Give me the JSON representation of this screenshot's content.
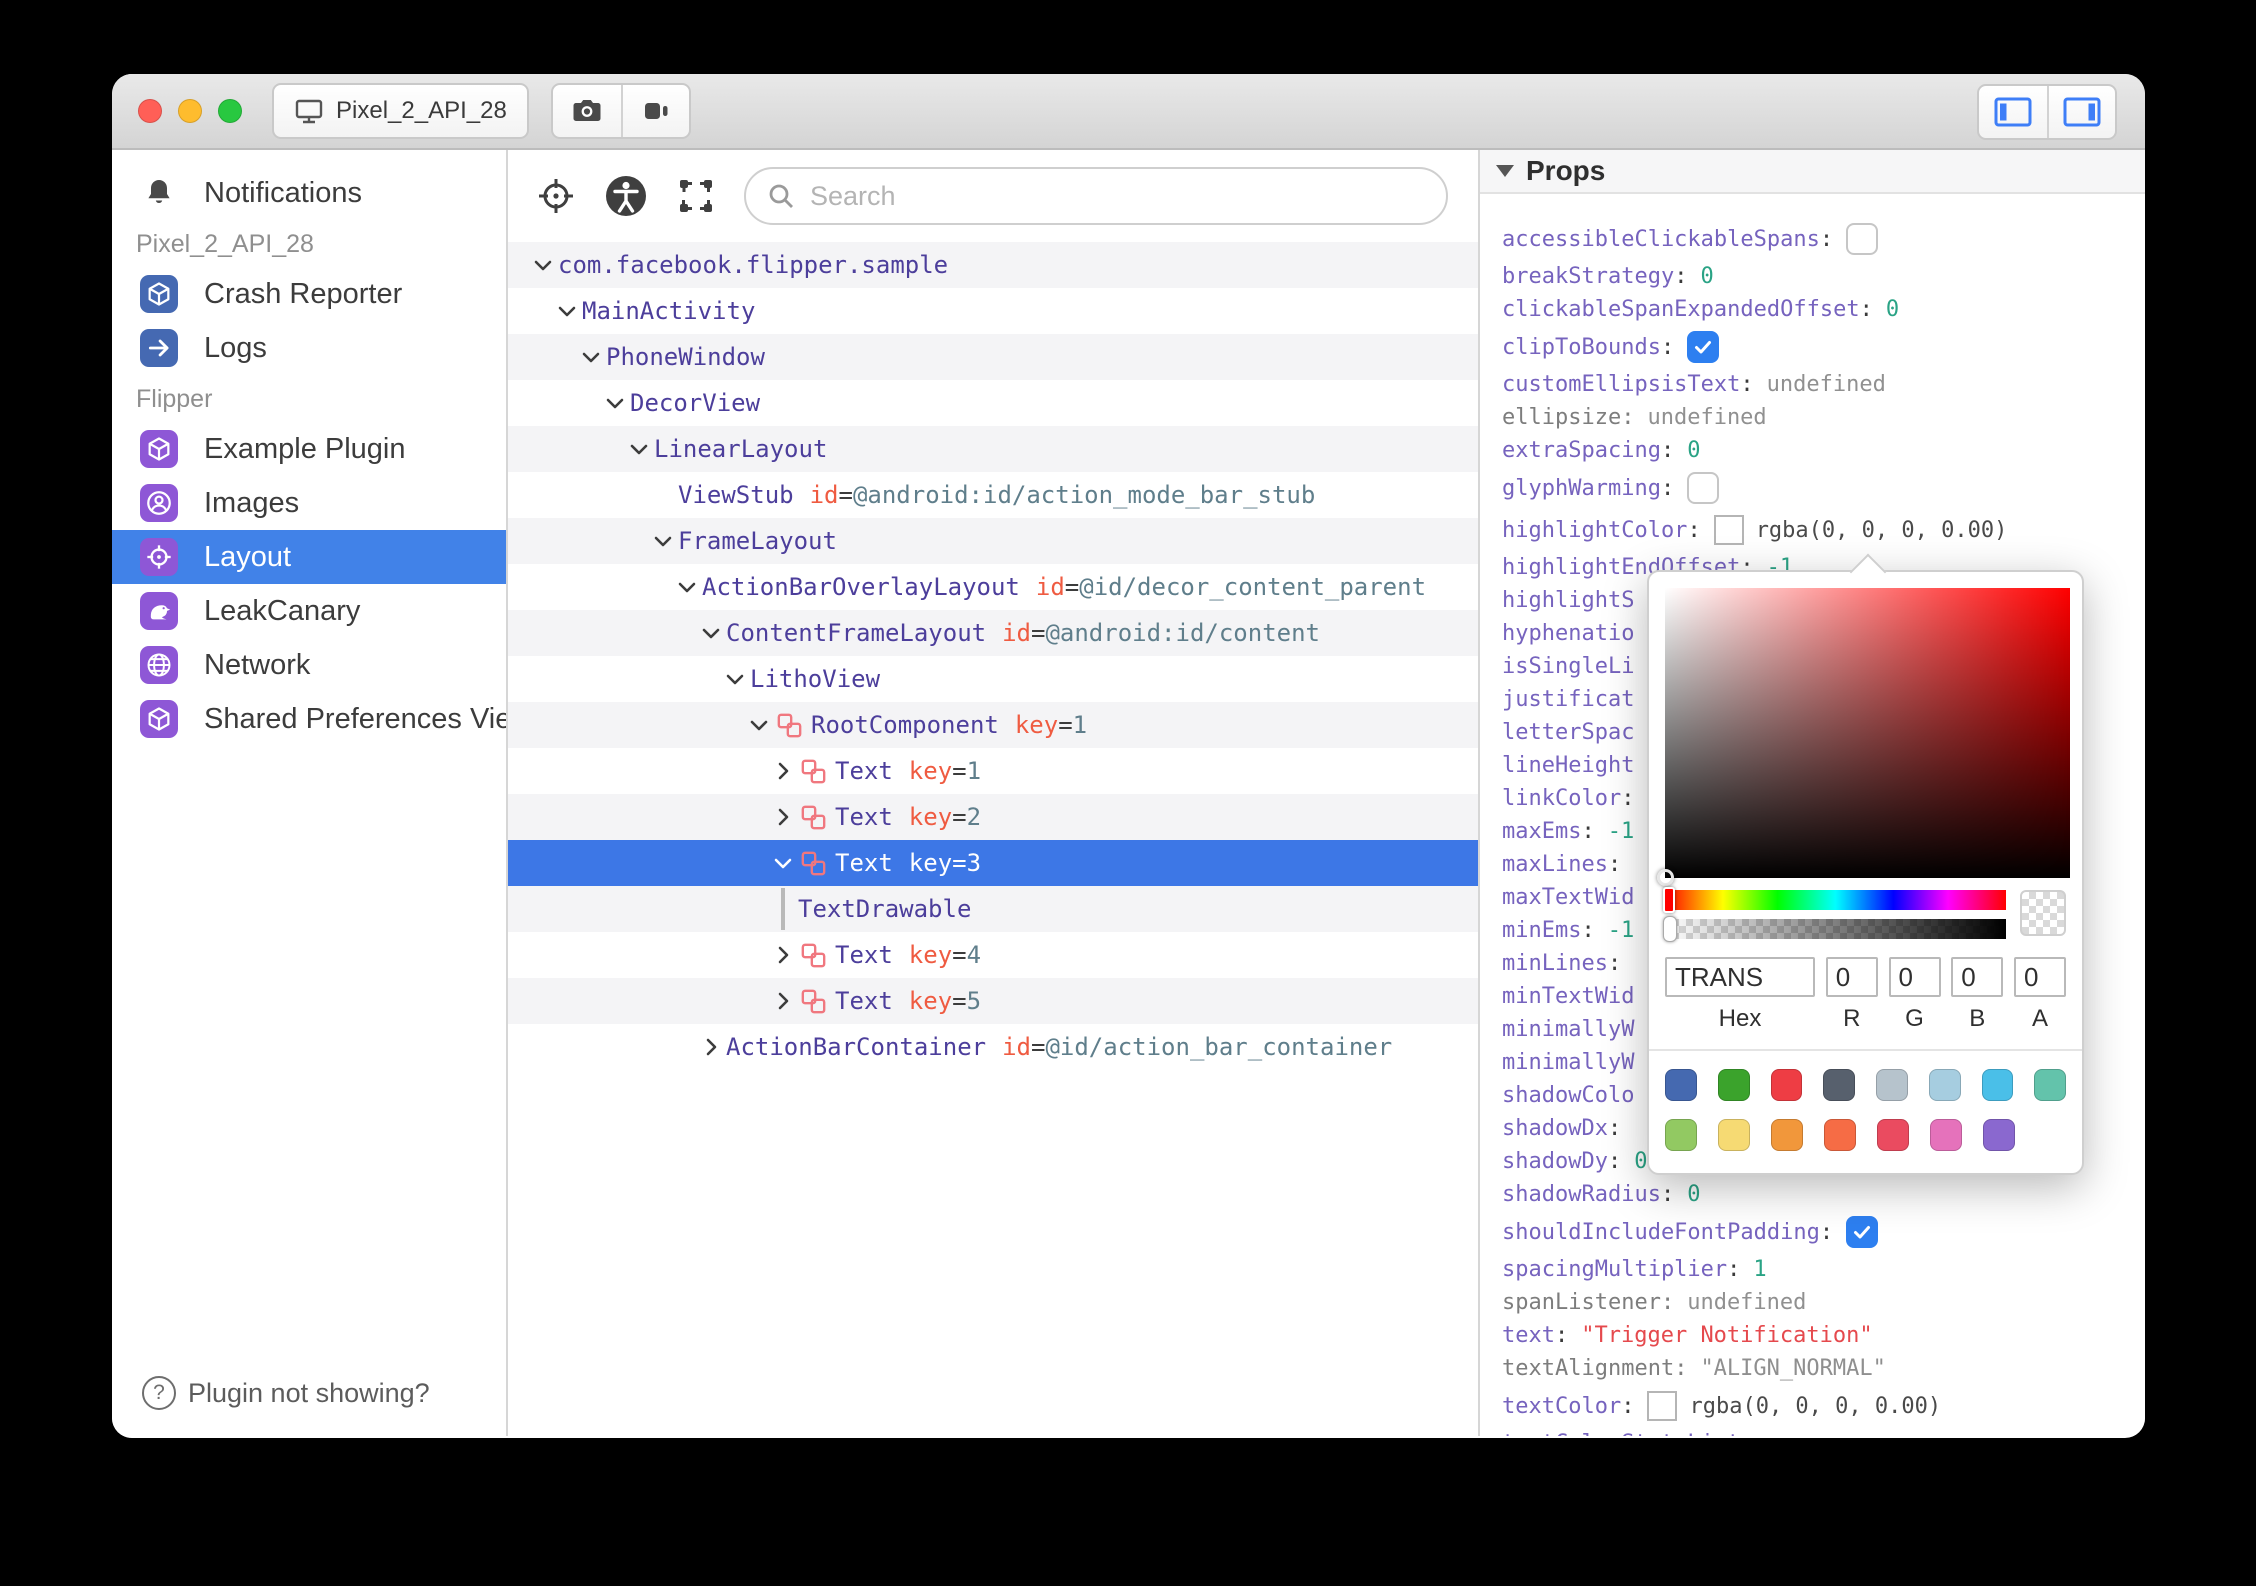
{
  "titlebar": {
    "device_name": "Pixel_2_API_28",
    "traffic_lights": [
      "#ff5f57",
      "#febc2e",
      "#28c840"
    ]
  },
  "sidebar": {
    "items": [
      {
        "label": "Notifications",
        "icon": "bell"
      },
      {
        "type": "section",
        "label": "Pixel_2_API_28"
      },
      {
        "label": "Crash Reporter",
        "icon": "cube",
        "icon_bg": "#4569b2"
      },
      {
        "label": "Logs",
        "icon": "arrow-right",
        "icon_bg": "#4569b2"
      },
      {
        "type": "section",
        "label": "Flipper"
      },
      {
        "label": "Example Plugin",
        "icon": "cube",
        "icon_bg": "#8e57d6"
      },
      {
        "label": "Images",
        "icon": "person-circle",
        "icon_bg": "#8e57d6"
      },
      {
        "label": "Layout",
        "icon": "target",
        "icon_bg": "#8e57d6",
        "selected": true
      },
      {
        "label": "LeakCanary",
        "icon": "bird",
        "icon_bg": "#8e57d6"
      },
      {
        "label": "Network",
        "icon": "globe",
        "icon_bg": "#8e57d6"
      },
      {
        "label": "Shared Preferences Viewer",
        "icon": "cube",
        "icon_bg": "#8e57d6"
      }
    ],
    "footer_help": "Plugin not showing?"
  },
  "inspector": {
    "search_placeholder": "Search",
    "tree": [
      {
        "indent": 0,
        "chevron": "down",
        "name": "com.facebook.flipper.sample"
      },
      {
        "indent": 1,
        "chevron": "down",
        "name": "MainActivity"
      },
      {
        "indent": 2,
        "chevron": "down",
        "name": "PhoneWindow"
      },
      {
        "indent": 3,
        "chevron": "down",
        "name": "DecorView"
      },
      {
        "indent": 4,
        "chevron": "down",
        "name": "LinearLayout"
      },
      {
        "indent": 5,
        "chevron": "none",
        "name": "ViewStub",
        "attrs": [
          {
            "k": "id",
            "v": "@android:id/action_mode_bar_stub"
          }
        ]
      },
      {
        "indent": 5,
        "chevron": "down",
        "name": "FrameLayout"
      },
      {
        "indent": 6,
        "chevron": "down",
        "name": "ActionBarOverlayLayout",
        "attrs": [
          {
            "k": "id",
            "v": "@id/decor_content_parent"
          }
        ]
      },
      {
        "indent": 7,
        "chevron": "down",
        "name": "ContentFrameLayout",
        "attrs": [
          {
            "k": "id",
            "v": "@android:id/content"
          }
        ]
      },
      {
        "indent": 8,
        "chevron": "down",
        "name": "LithoView"
      },
      {
        "indent": 9,
        "chevron": "down",
        "litho": true,
        "name": "RootComponent",
        "attrs": [
          {
            "k": "key",
            "v": "1"
          }
        ]
      },
      {
        "indent": 10,
        "chevron": "right",
        "litho": true,
        "name": "Text",
        "attrs": [
          {
            "k": "key",
            "v": "1"
          }
        ]
      },
      {
        "indent": 10,
        "chevron": "right",
        "litho": true,
        "name": "Text",
        "attrs": [
          {
            "k": "key",
            "v": "2"
          }
        ]
      },
      {
        "indent": 10,
        "chevron": "down",
        "litho": true,
        "name": "Text",
        "attrs": [
          {
            "k": "key",
            "v": "3"
          }
        ],
        "selected": true
      },
      {
        "indent": 10,
        "chevron": "bar",
        "name": "TextDrawable"
      },
      {
        "indent": 10,
        "chevron": "right",
        "litho": true,
        "name": "Text",
        "attrs": [
          {
            "k": "key",
            "v": "4"
          }
        ]
      },
      {
        "indent": 10,
        "chevron": "right",
        "litho": true,
        "name": "Text",
        "attrs": [
          {
            "k": "key",
            "v": "5"
          }
        ]
      },
      {
        "indent": 7,
        "chevron": "right",
        "name": "ActionBarContainer",
        "attrs": [
          {
            "k": "id",
            "v": "@id/action_bar_container"
          }
        ]
      }
    ]
  },
  "props_panel": {
    "title": "Props",
    "rows": [
      {
        "name": "accessibleClickableSpans",
        "type": "checkbox",
        "checked": false
      },
      {
        "name": "breakStrategy",
        "type": "number",
        "value": "0"
      },
      {
        "name": "clickableSpanExpandedOffset",
        "type": "number",
        "value": "0"
      },
      {
        "name": "clipToBounds",
        "type": "checkbox",
        "checked": true
      },
      {
        "name": "customEllipsisText",
        "type": "undefined",
        "value": "undefined"
      },
      {
        "name": "ellipsize",
        "gray": true,
        "type": "undefined",
        "value": "undefined"
      },
      {
        "name": "extraSpacing",
        "type": "number",
        "value": "0"
      },
      {
        "name": "glyphWarming",
        "type": "checkbox",
        "checked": false
      },
      {
        "name": "highlightColor",
        "type": "color",
        "value": "rgba(0, 0, 0, 0.00)"
      },
      {
        "name": "highlightEndOffset",
        "type": "number",
        "value": "-1"
      },
      {
        "name": "highlightS",
        "colon": false
      },
      {
        "name": "hyphenatio",
        "colon": false
      },
      {
        "name": "isSingleLi",
        "colon": false
      },
      {
        "name": "justificat",
        "colon": false
      },
      {
        "name": "letterSpac",
        "colon": false
      },
      {
        "name": "lineHeight",
        "colon": false
      },
      {
        "name": "linkColor"
      },
      {
        "name": "maxEms",
        "type": "number",
        "value": "-1"
      },
      {
        "name": "maxLines"
      },
      {
        "name": "maxTextWid",
        "colon": false
      },
      {
        "name": "minEms",
        "type": "number",
        "value": "-1"
      },
      {
        "name": "minLines"
      },
      {
        "name": "minTextWid",
        "colon": false
      },
      {
        "name": "minimallyW",
        "colon": false
      },
      {
        "name": "minimallyW",
        "colon": false
      },
      {
        "name": "shadowColo",
        "colon": false
      },
      {
        "name": "shadowDx"
      },
      {
        "name": "shadowDy",
        "type": "number",
        "value": "0"
      },
      {
        "name": "shadowRadius",
        "type": "number",
        "value": "0"
      },
      {
        "name": "shouldIncludeFontPadding",
        "type": "checkbox",
        "checked": true
      },
      {
        "name": "spacingMultiplier",
        "type": "number",
        "value": "1"
      },
      {
        "name": "spanListener",
        "gray": true,
        "type": "undefined",
        "value": "undefined"
      },
      {
        "name": "text",
        "type": "string_red",
        "value": "\"Trigger Notification\""
      },
      {
        "name": "textAlignment",
        "gray": true,
        "type": "string_gray",
        "value": "\"ALIGN_NORMAL\""
      },
      {
        "name": "textColor",
        "type": "color",
        "value": "rgba(0, 0, 0, 0.00)"
      },
      {
        "name": "textColorStateList",
        "partial": true
      }
    ]
  },
  "color_picker": {
    "hex": "TRANS",
    "r": "0",
    "g": "0",
    "b": "0",
    "a": "0",
    "labels": [
      "Hex",
      "R",
      "G",
      "B",
      "A"
    ],
    "swatches_row1": [
      "#4569b0",
      "#3ba32c",
      "#ee3d44",
      "#57606d",
      "#b6c3cc",
      "#a6cde0",
      "#4abfe8",
      "#63c3ab"
    ],
    "swatches_row2": [
      "#92c962",
      "#f6da73",
      "#f1973b",
      "#f66c45",
      "#ea4b60",
      "#e572bb",
      "#8a68cf"
    ]
  },
  "accents": {
    "selection_blue": "#3d77e6",
    "sidebar_selection_blue": "#4182e8",
    "checkbox_blue": "#2d7ff0",
    "tree_purple": "#4c3e9b",
    "props_purple": "#7663be",
    "attr_orange": "#ef5b41",
    "attr_slate": "#5f7e8b",
    "number_teal": "#2aa385",
    "string_red": "#e5494d",
    "litho_salmon": "#f0777f",
    "plugin_purple": "#8e57d6",
    "plugin_blue": "#4569b2",
    "toggle_blue": "#3e7ef7"
  }
}
